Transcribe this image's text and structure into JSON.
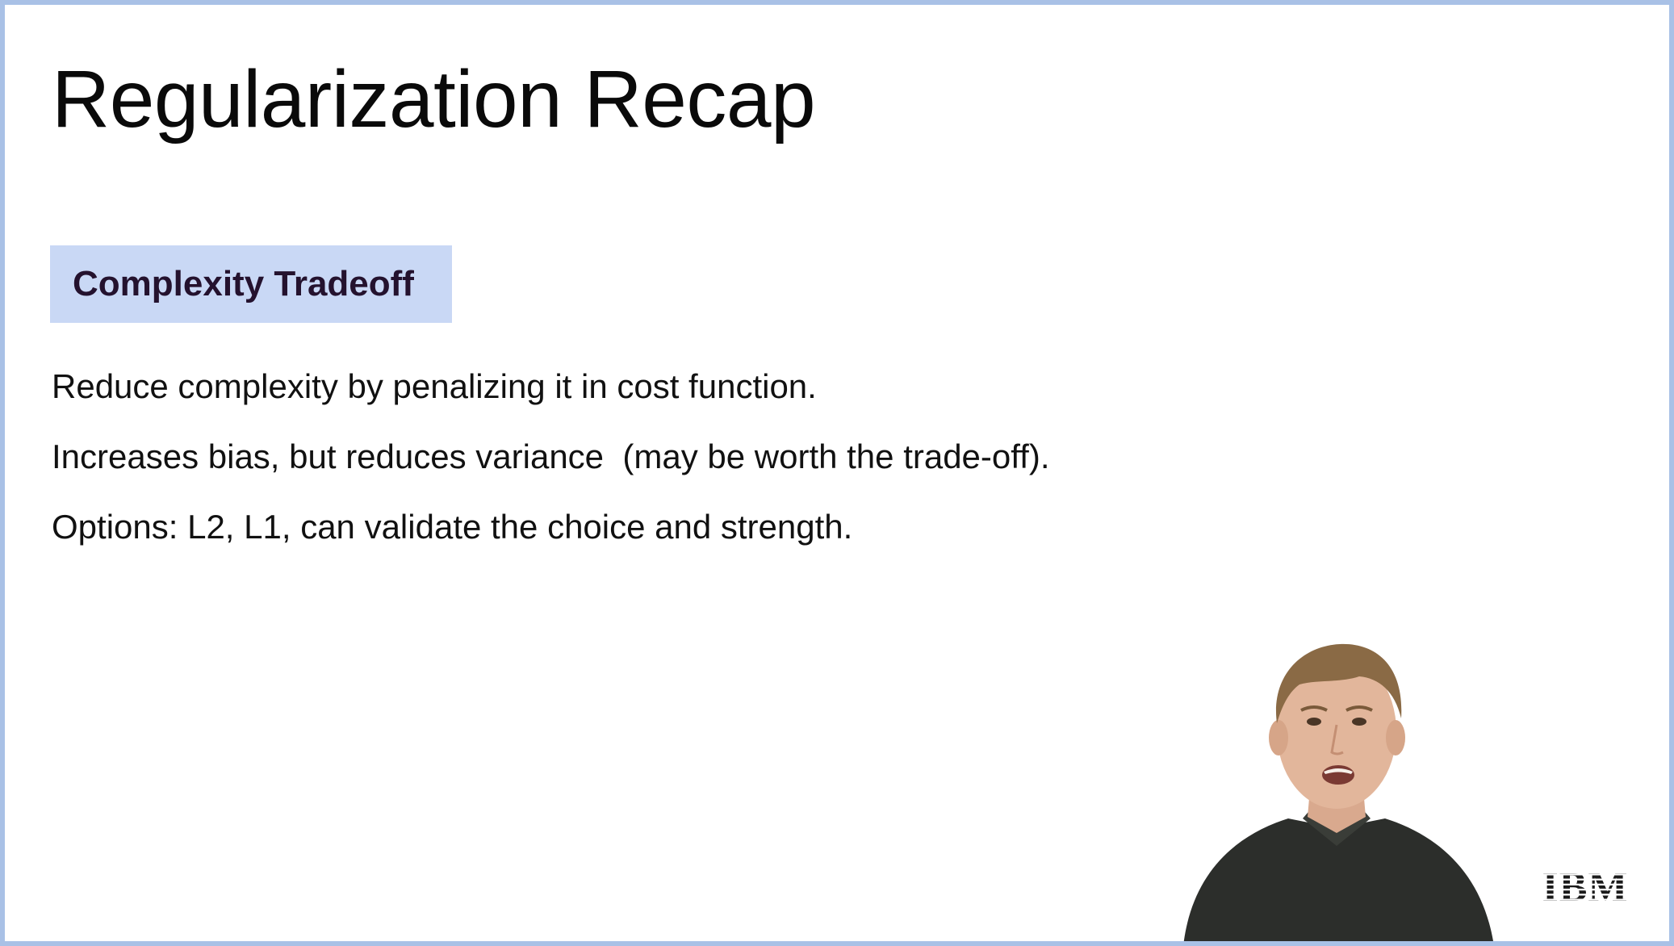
{
  "slide": {
    "title": "Regularization Recap",
    "section_label": "Complexity Tradeoff",
    "bullets": [
      "Reduce complexity by penalizing it in cost function.",
      "Increases bias, but reduces variance  (may be worth the trade-off).",
      "Options: L2, L1, can validate the choice and strength."
    ]
  },
  "brand": {
    "logo_text": "IBM"
  },
  "colors": {
    "frame_border": "#a9c1e6",
    "section_label_bg": "#c9d8f5",
    "section_label_text": "#24122e",
    "body_text": "#111111"
  }
}
